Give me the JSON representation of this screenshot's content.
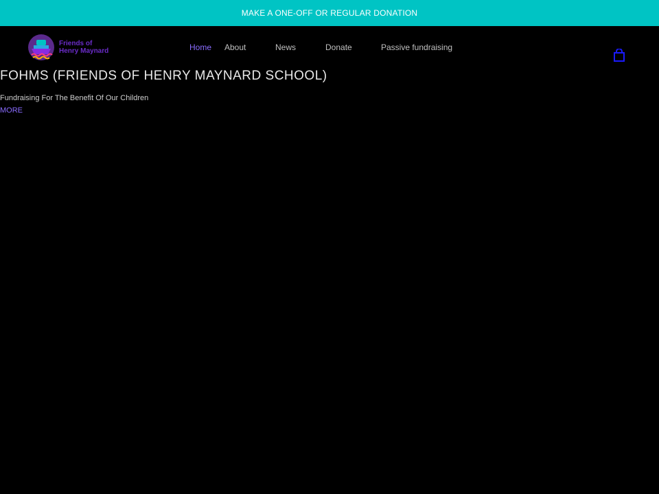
{
  "banner": {
    "label": "MAKE A ONE-OFF OR REGULAR DONATION"
  },
  "logo": {
    "text": "Friends of\nHenry Maynard",
    "icon": "ship-logo-icon"
  },
  "nav": {
    "items": [
      {
        "label": "Home",
        "active": true
      },
      {
        "label": "About",
        "active": false
      },
      {
        "label": "News",
        "active": false
      },
      {
        "label": "Donate",
        "active": false
      },
      {
        "label": "Passive fundraising",
        "active": false
      }
    ]
  },
  "cart": {
    "icon": "shopping-bag-icon"
  },
  "hero": {
    "title": "FOHMS (FRIENDS OF HENRY MAYNARD SCHOOL)",
    "subtitle": "Fundraising For The Benefit Of Our Children",
    "more_label": "MORE"
  },
  "colors": {
    "banner_bg": "#00C4C4",
    "accent": "#8a6cff",
    "logo_purple": "#6A2CC8",
    "background": "#000000"
  }
}
